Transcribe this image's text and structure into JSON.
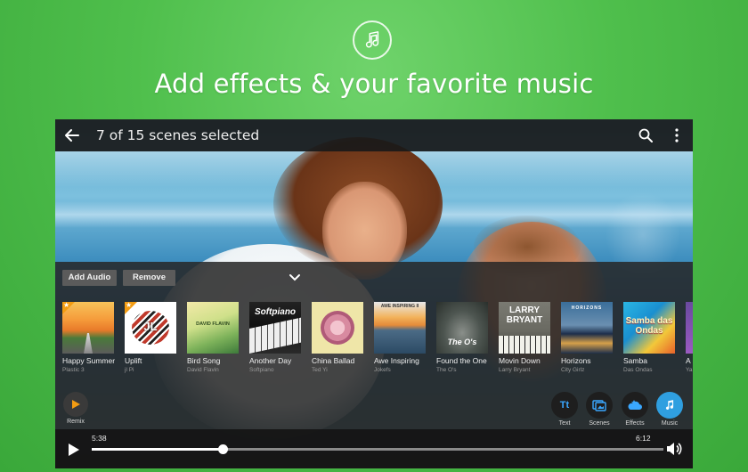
{
  "headline": "Add effects & your favorite music",
  "app": {
    "top_title": "7 of 15 scenes selected"
  },
  "actions": {
    "add_audio": "Add Audio",
    "remove": "Remove"
  },
  "tracks": [
    {
      "title": "Happy Summer",
      "artist": "Plastic 3",
      "starred": true
    },
    {
      "title": "Uplift",
      "artist": "jl Pi",
      "starred": true,
      "cover_text": "JL"
    },
    {
      "title": "Bird Song",
      "artist": "David Flavin",
      "cover_text": "DAVID FLAVIN"
    },
    {
      "title": "Another Day",
      "artist": "Softpiano",
      "cover_text": "Softpiano"
    },
    {
      "title": "China Ballad",
      "artist": "Ted Yi"
    },
    {
      "title": "Awe Inspiring",
      "artist": "Jokefs",
      "cover_text": "AWE INSPIRING II"
    },
    {
      "title": "Found the One",
      "artist": "The O's",
      "cover_text": "The O's"
    },
    {
      "title": "Movin Down",
      "artist": "Larry Bryant",
      "cover_text": "LARRY BRYANT"
    },
    {
      "title": "Horizons",
      "artist": "City Girlz",
      "cover_text": "HORIZONS"
    },
    {
      "title": "Samba",
      "artist": "Das Ondas",
      "cover_text": "Samba das Ondas"
    },
    {
      "title": "A",
      "artist": "Ya"
    }
  ],
  "tools": {
    "remix": "Remix",
    "text": "Text",
    "text_glyph": "Tt",
    "scenes": "Scenes",
    "effects": "Effects",
    "music": "Music"
  },
  "player": {
    "elapsed": "5:38",
    "total": "6:12",
    "progress": 0.23
  },
  "colors": {
    "background": "#4fbf4c",
    "accent": "#2f9fe0",
    "star_badge": "#f39c12"
  }
}
